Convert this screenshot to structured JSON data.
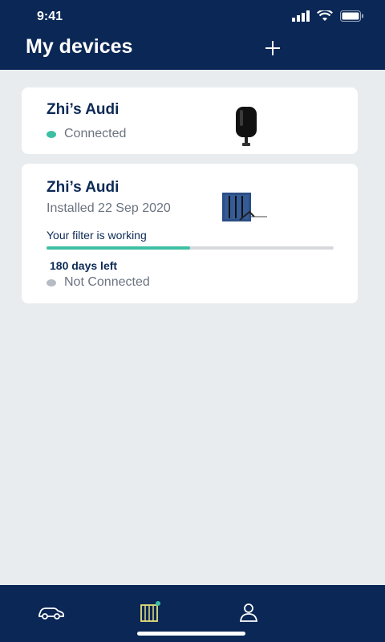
{
  "status_bar": {
    "time": "9:41"
  },
  "header": {
    "title": "My devices"
  },
  "devices": [
    {
      "name": "Zhi’s Audi",
      "status": "Connected",
      "status_color": "#3dbfa3"
    },
    {
      "name": "Zhi’s Audi",
      "installed": "Installed 22 Sep 2020",
      "filter_status": "Your filter is working",
      "filter_progress": 0.5,
      "days_left": "180 days left",
      "status": "Not Connected",
      "status_color": "#b6bcc4"
    }
  ],
  "tabbar": {
    "tabs": [
      {
        "icon": "car-icon",
        "active": false
      },
      {
        "icon": "filter-icon",
        "active": true,
        "badge": true
      },
      {
        "icon": "user-icon",
        "active": false
      }
    ],
    "accent_color": "#e5e27a",
    "badge_color": "#3dbfa3"
  }
}
